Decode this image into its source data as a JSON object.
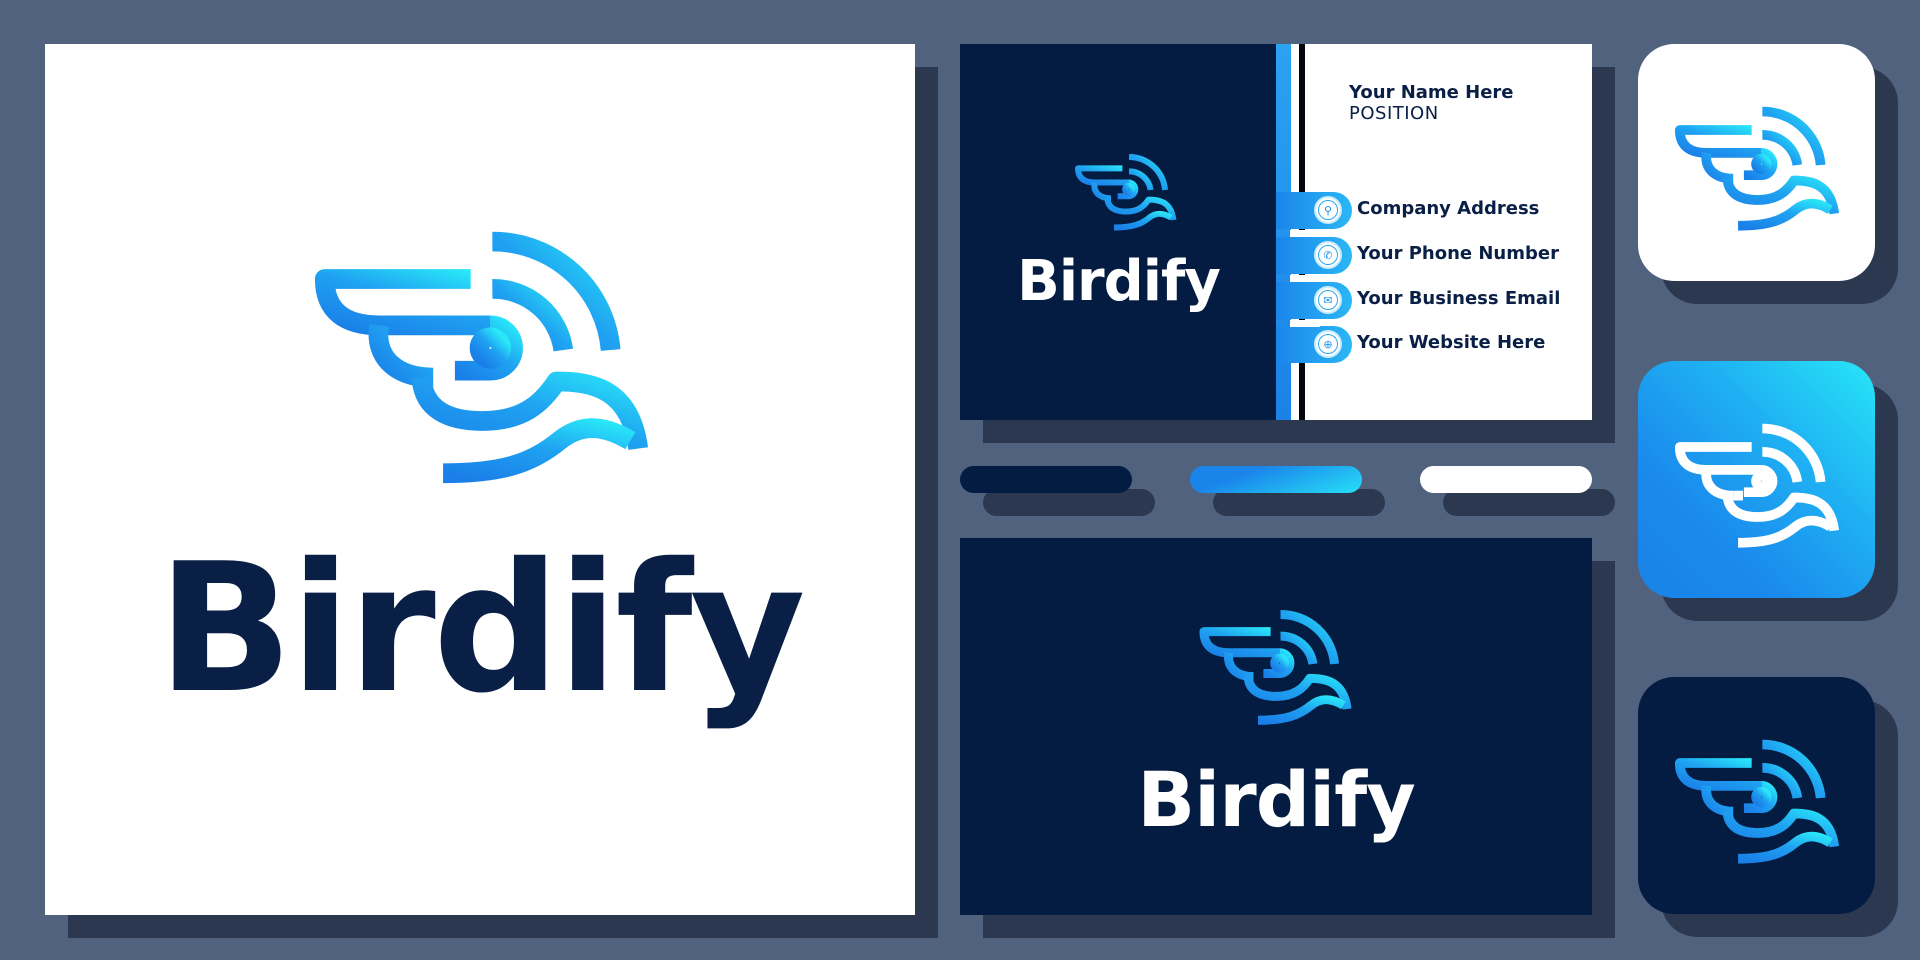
{
  "brand": {
    "name": "Birdify",
    "wordmark_parts": [
      "B",
      "i",
      "rd",
      "i",
      "fy"
    ],
    "colors": {
      "navy": "#041c41",
      "text_navy": "#0a1f45",
      "blue": "#1a84ea",
      "cyan": "#27e0f7",
      "i_dot": "#26aaf3",
      "background": "#51627f",
      "shadow": "#2b3850",
      "white": "#ffffff"
    }
  },
  "logo_icon": "bird-head-wing-signal-icon",
  "main_panel": {
    "logo_icon": "bird-logo-icon",
    "wordmark": "Birdify"
  },
  "business_card": {
    "front": {
      "wordmark": "Birdify"
    },
    "back": {
      "name": "Your Name Here",
      "position": "POSITION",
      "contacts": [
        {
          "icon": "location-pin-icon",
          "glyph": "⚲",
          "label": "Company Address"
        },
        {
          "icon": "phone-icon",
          "glyph": "✆",
          "label": "Your Phone Number"
        },
        {
          "icon": "envelope-icon",
          "glyph": "✉",
          "label": "Your Business Email"
        },
        {
          "icon": "globe-icon",
          "glyph": "⊕",
          "label": "Your Website Here"
        }
      ]
    }
  },
  "swatches": [
    {
      "name": "navy",
      "color": "#041c41"
    },
    {
      "name": "blue-gradient",
      "color": "#1a84ea"
    },
    {
      "name": "white",
      "color": "#ffffff"
    }
  ],
  "wide_card": {
    "wordmark": "Birdify"
  },
  "app_icons": [
    {
      "variant": "white",
      "background": "#ffffff",
      "logo": "gradient"
    },
    {
      "variant": "gradient",
      "background": "#1a84ea",
      "logo": "white"
    },
    {
      "variant": "dark",
      "background": "#041c41",
      "logo": "gradient"
    }
  ]
}
